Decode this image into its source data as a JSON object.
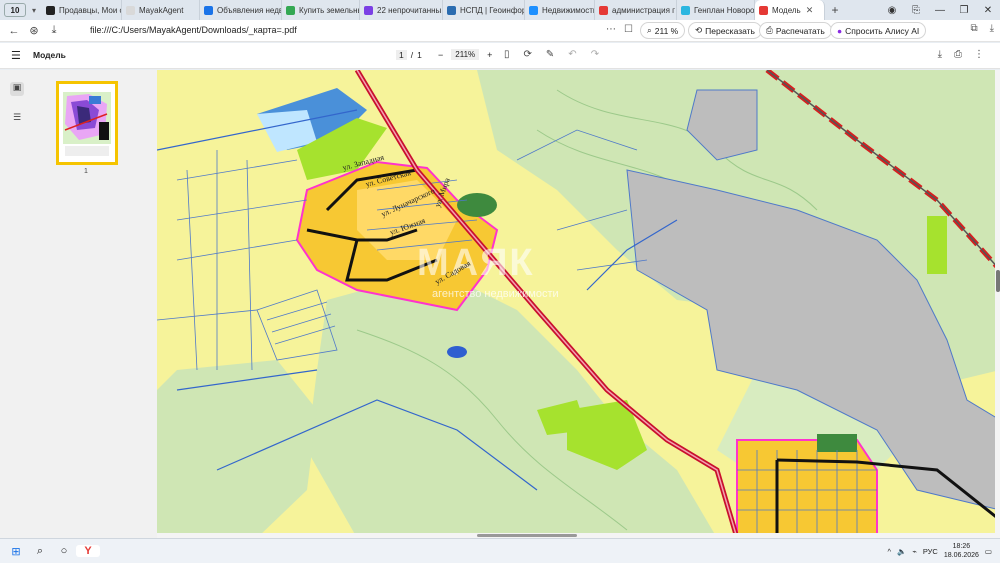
{
  "browser": {
    "tab_count": "10",
    "tabs": [
      {
        "label": "Продавцы, Мои о",
        "color": "#222"
      },
      {
        "label": "MayakAgent",
        "color": "#d9d9d9"
      },
      {
        "label": "Объявления недв",
        "color": "#1a73e8"
      },
      {
        "label": "Купить земельны",
        "color": "#34a853"
      },
      {
        "label": "22 непрочитанны",
        "color": "#7b3fe4"
      },
      {
        "label": "НСПД | Геоинфор",
        "color": "#2b6cb0"
      },
      {
        "label": "Недвижимость",
        "color": "#1e90ff"
      },
      {
        "label": "администрация г",
        "color": "#e53935"
      },
      {
        "label": "Генплан Новорос",
        "color": "#2bb6e0"
      },
      {
        "label": "Модель",
        "color": "#e53935"
      }
    ],
    "url": "file:///C:/Users/MayakAgent/Downloads/_карта=.pdf",
    "zoom": "211 %",
    "translate_label": "Пересказать",
    "print_label": "Распечатать",
    "alice_label": "Спросить Алису AI"
  },
  "pdf": {
    "title": "Модель",
    "page_current": "1",
    "page_sep": "/",
    "page_total": "1",
    "zoom": "211%",
    "thumb_label": "1"
  },
  "map": {
    "watermark": "МАЯК",
    "watermark_sub": "агентство недвижимости",
    "streets": [
      "ул. Западная",
      "ул. Советская",
      "ул. Луначарского",
      "ул. Южная",
      "ул. Мира",
      "ул. Садовая"
    ]
  },
  "taskbar": {
    "lang": "РУС",
    "time": "18:26",
    "date": "18.06.2026"
  }
}
